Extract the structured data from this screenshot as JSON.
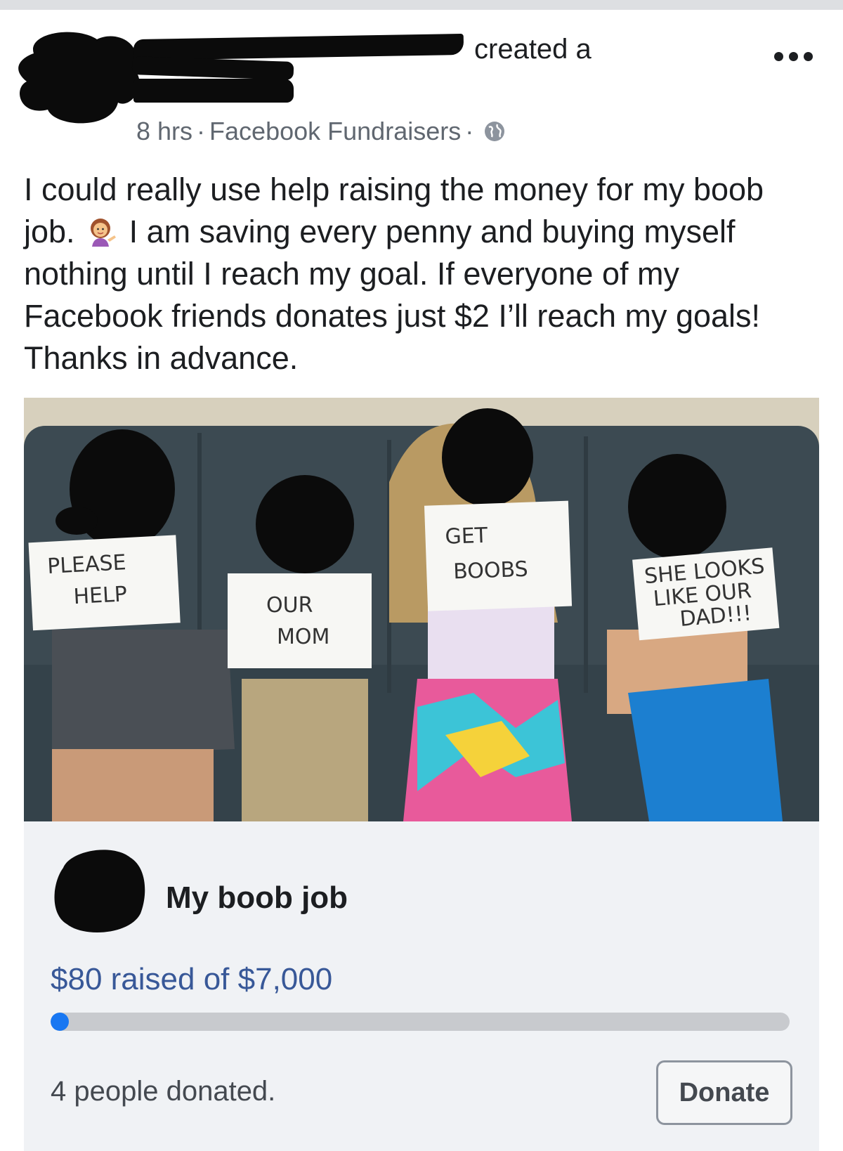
{
  "post": {
    "header": {
      "action_text": "created a",
      "time": "8 hrs",
      "separator": "·",
      "source": "Facebook Fundraisers",
      "separator2": "·"
    },
    "text_line1": "I could really use help raising the money for my boob",
    "text_line2_a": "job.",
    "text_line2_b": "I am saving every penny and buying myself",
    "text_line3": "nothing until I reach my goal. If everyone of my",
    "text_line4": "Facebook friends donates just $2 I’ll reach my goals!",
    "text_line5": "Thanks in advance."
  },
  "photo": {
    "signs": {
      "sign1_line1": "PLEASE",
      "sign1_line2": "HELP",
      "sign2_line1": "OUR",
      "sign2_line2": "MOM",
      "sign3_line1": "GET",
      "sign3_line2": "BOOBS",
      "sign4_line1": "SHE LOOKS",
      "sign4_line2": "LIKE OUR",
      "sign4_line3": "DAD!!!"
    }
  },
  "fundraiser": {
    "title": "My boob job",
    "raised_text": "$80 raised of $7,000",
    "progress_fraction": 0.0114,
    "donors_text": "4 people donated.",
    "donate_label": "Donate"
  },
  "colors": {
    "link_blue": "#385898",
    "progress_blue": "#1877f2",
    "card_bg": "#f0f2f5"
  }
}
